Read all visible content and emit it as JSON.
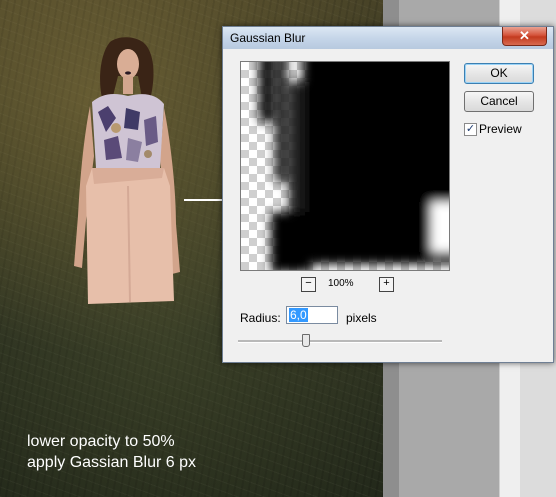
{
  "dialog": {
    "title": "Gaussian Blur",
    "close_glyph": "✕",
    "ok_label": "OK",
    "cancel_label": "Cancel",
    "preview_label": "Preview",
    "preview_checked": true,
    "check_glyph": "✓",
    "zoom_level": "100%",
    "zoom_out_label": "−",
    "zoom_in_label": "+",
    "radius_label": "Radius:",
    "radius_value": "6,0",
    "radius_units": "pixels"
  },
  "caption": {
    "line1": "lower opacity to 50%",
    "line2": "apply Gassian Blur 6 px"
  },
  "colors": {
    "accent_selection": "#3399ff",
    "close_button": "#c33a1f"
  },
  "icons": {
    "arrow": "arrow-right-icon",
    "close": "close-icon",
    "check": "checkmark-icon"
  }
}
